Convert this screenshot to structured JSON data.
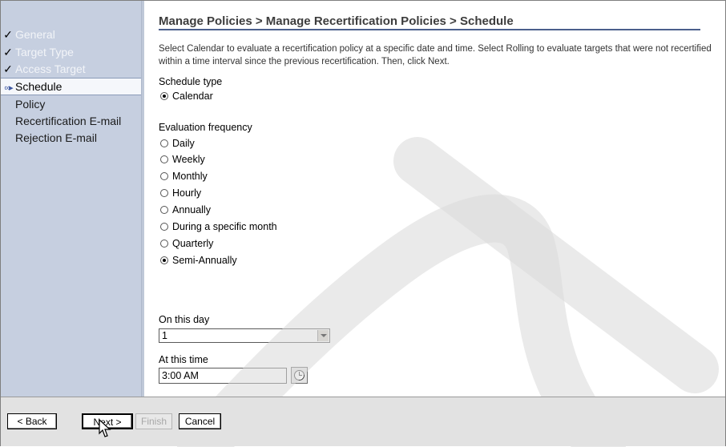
{
  "wizard": {
    "steps": [
      {
        "label": "General",
        "status": "done"
      },
      {
        "label": "Target Type",
        "status": "done"
      },
      {
        "label": "Access Target",
        "status": "done"
      },
      {
        "label": "Schedule",
        "status": "current"
      },
      {
        "label": "Policy",
        "status": "todo"
      },
      {
        "label": "Recertification E-mail",
        "status": "todo"
      },
      {
        "label": "Rejection E-mail",
        "status": "todo"
      }
    ],
    "done_mark": "✓",
    "current_mark": "∞▸"
  },
  "main": {
    "breadcrumb_title": "Manage Policies > Manage Recertification Policies > Schedule",
    "instructions": "Select Calendar to evaluate a recertification policy at a specific date and time. Select Rolling to evaluate targets that were not recertified within a time interval since the previous recertification. Then, click Next.",
    "schedule_type": {
      "label": "Schedule type",
      "options": [
        {
          "label": "Calendar",
          "selected": true
        }
      ]
    },
    "evaluation_frequency": {
      "label": "Evaluation frequency",
      "options": [
        {
          "label": "Daily",
          "selected": false
        },
        {
          "label": "Weekly",
          "selected": false
        },
        {
          "label": "Monthly",
          "selected": false
        },
        {
          "label": "Hourly",
          "selected": false
        },
        {
          "label": "Annually",
          "selected": false
        },
        {
          "label": "During a specific month",
          "selected": false
        },
        {
          "label": "Quarterly",
          "selected": false
        },
        {
          "label": "Semi-Annually",
          "selected": true
        }
      ]
    },
    "on_this_day": {
      "label": "On this day",
      "value": "1"
    },
    "at_this_time": {
      "label": "At this time",
      "value": "3:00 AM"
    }
  },
  "footer": {
    "back_label": "< Back",
    "next_label": "Next >",
    "finish_label": "Finish",
    "cancel_label": "Cancel"
  },
  "icons": {
    "check": "check-icon",
    "current_step": "current-step-arrow-icon",
    "dropdown": "chevron-down-icon",
    "clock": "clock-icon",
    "cursor": "mouse-pointer-icon"
  }
}
